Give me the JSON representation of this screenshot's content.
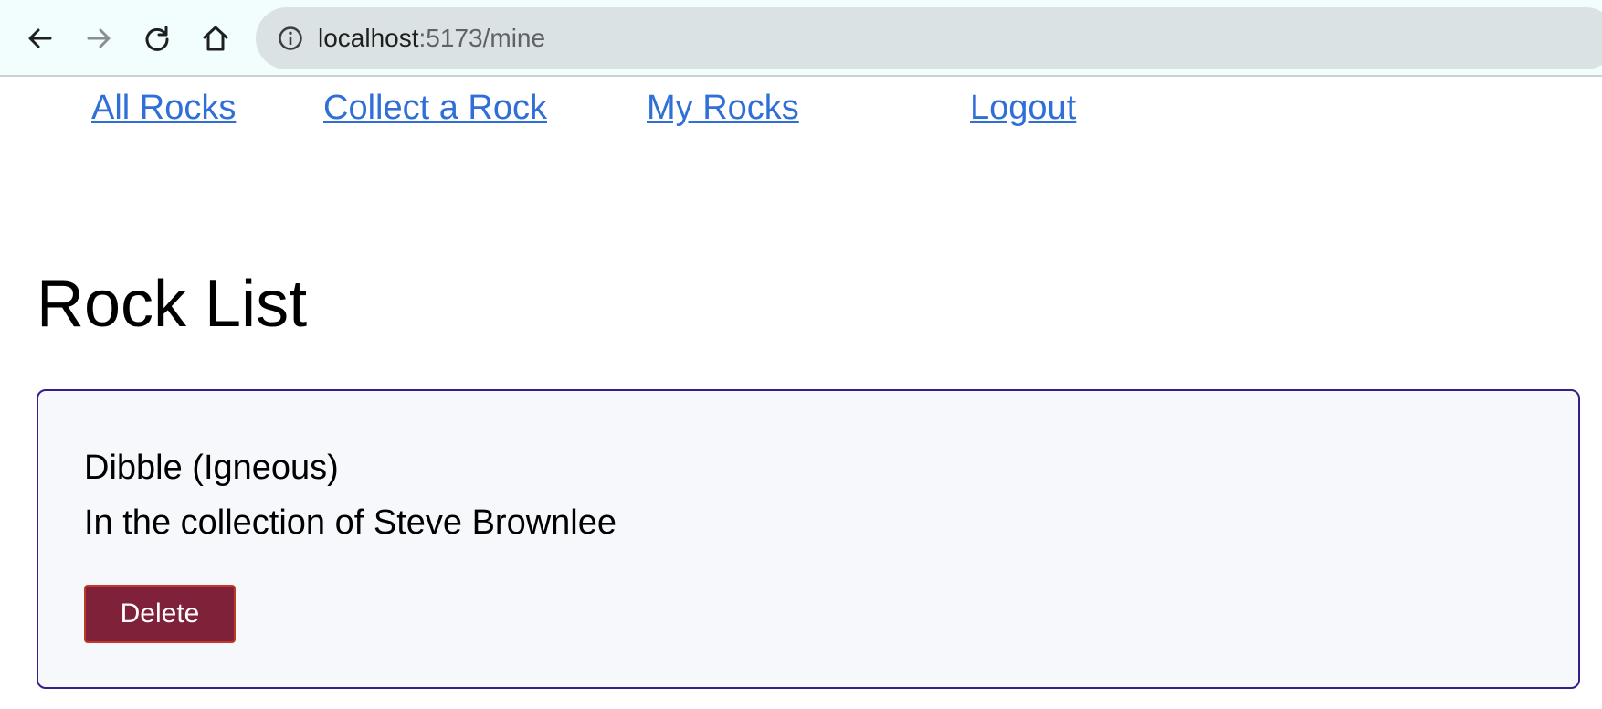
{
  "browser": {
    "url_host": "localhost",
    "url_path": ":5173/mine",
    "icons": [
      "back-arrow-icon",
      "forward-arrow-icon",
      "reload-icon",
      "home-icon",
      "info-icon"
    ]
  },
  "nav": {
    "items": [
      {
        "label": "All Rocks"
      },
      {
        "label": "Collect a Rock"
      },
      {
        "label": "My Rocks"
      },
      {
        "label": "Logout"
      }
    ],
    "link_color": "#2f6fd6"
  },
  "page": {
    "title": "Rock List"
  },
  "rocks": [
    {
      "name": "Dibble (Igneous)",
      "owner_text": "In the collection of Steve Brownlee",
      "delete_label": "Delete"
    }
  ],
  "colors": {
    "card_border": "#3a1b8a",
    "card_background": "#f7f8fb",
    "delete_button": "#7f2139"
  }
}
